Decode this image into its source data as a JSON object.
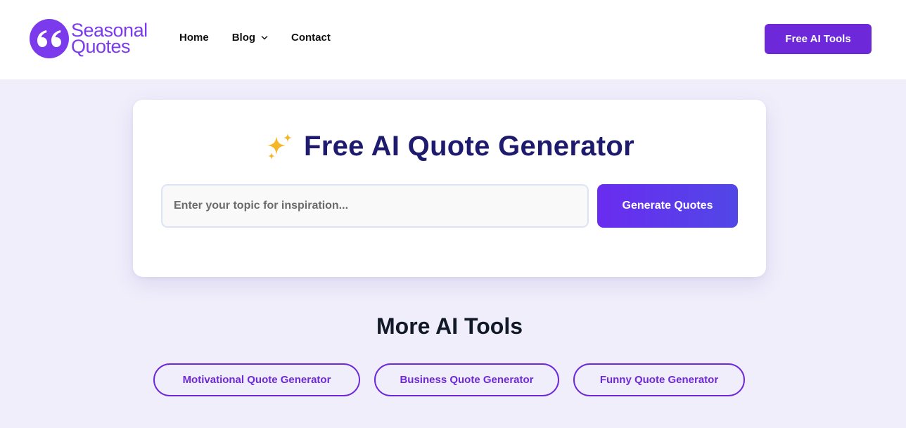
{
  "brand": {
    "name_line1": "Seasonal",
    "name_line2": "Quotes",
    "icon": "quote-marks-icon",
    "color": "#7c3aed"
  },
  "nav": {
    "items": [
      {
        "label": "Home"
      },
      {
        "label": "Blog",
        "has_dropdown": true
      },
      {
        "label": "Contact"
      }
    ]
  },
  "header_cta": {
    "label": "Free AI Tools"
  },
  "generator": {
    "title": "Free AI Quote Generator",
    "title_icon": "sparkles-icon",
    "input_placeholder": "Enter your topic for inspiration...",
    "input_value": "",
    "button_label": "Generate Quotes"
  },
  "more_tools": {
    "title": "More AI Tools",
    "items": [
      {
        "label": "Motivational Quote Generator"
      },
      {
        "label": "Business Quote Generator"
      },
      {
        "label": "Funny Quote Generator"
      }
    ]
  },
  "colors": {
    "accent": "#6d28d9",
    "title": "#1e1b6e",
    "background": "#f0eefb"
  }
}
